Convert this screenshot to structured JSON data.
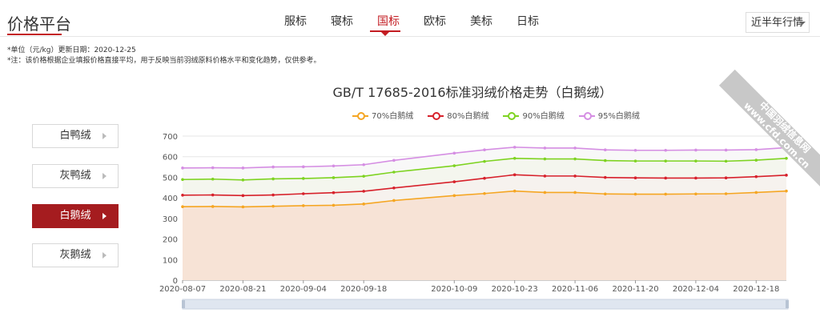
{
  "header": {
    "brand": "价格平台",
    "tabs": [
      {
        "label": "服标",
        "active": false
      },
      {
        "label": "寝标",
        "active": false
      },
      {
        "label": "国标",
        "active": true
      },
      {
        "label": "欧标",
        "active": false
      },
      {
        "label": "美标",
        "active": false
      },
      {
        "label": "日标",
        "active": false
      }
    ],
    "range_select": "近半年行情"
  },
  "notes": {
    "unit": "*单位（元/kg）更新日期：2020-12-25",
    "disclaimer": "*注：该价格根据企业填报价格直接平均，用于反映当前羽绒原料价格水平和变化趋势，仅供参考。"
  },
  "sidebar": {
    "items": [
      {
        "label": "白鸭绒",
        "active": false
      },
      {
        "label": "灰鸭绒",
        "active": false
      },
      {
        "label": "白鹅绒",
        "active": true
      },
      {
        "label": "灰鹅绒",
        "active": false
      }
    ]
  },
  "watermark": {
    "line1": "中国羽绒信息网",
    "line2": "www.cfd.com.cn"
  },
  "chart_data": {
    "type": "area",
    "title": "GB/T 17685-2016标准羽绒价格走势（白鹅绒）",
    "x_tick_labels": [
      "2020-08-07",
      "2020-08-21",
      "2020-09-04",
      "2020-09-18",
      "2020-10-09",
      "2020-10-23",
      "2020-11-06",
      "2020-11-20",
      "2020-12-04",
      "2020-12-18"
    ],
    "ylim": [
      0,
      700
    ],
    "y_ticks": [
      0,
      100,
      200,
      300,
      400,
      500,
      600,
      700
    ],
    "grid": true,
    "legend_position": "top-center",
    "x": [
      "2020-08-07",
      "2020-08-14",
      "2020-08-21",
      "2020-08-28",
      "2020-09-04",
      "2020-09-11",
      "2020-09-18",
      "2020-09-25",
      "2020-10-09",
      "2020-10-16",
      "2020-10-23",
      "2020-10-30",
      "2020-11-06",
      "2020-11-13",
      "2020-11-20",
      "2020-11-27",
      "2020-12-04",
      "2020-12-11",
      "2020-12-18",
      "2020-12-25"
    ],
    "series": [
      {
        "name": "70%白鹅绒",
        "color": "#f5a623",
        "fill": "#f7e3d6",
        "values": [
          357,
          358,
          356,
          359,
          362,
          364,
          370,
          387,
          411,
          421,
          433,
          426,
          426,
          419,
          418,
          418,
          419,
          420,
          426,
          433
        ]
      },
      {
        "name": "80%白鹅绒",
        "color": "#d7212b",
        "fill": "#f6f2ee",
        "values": [
          413,
          414,
          411,
          414,
          420,
          425,
          432,
          448,
          478,
          495,
          512,
          506,
          506,
          499,
          497,
          496,
          496,
          497,
          503,
          510
        ]
      },
      {
        "name": "90%白鹅绒",
        "color": "#7ed321",
        "fill": "#f4f6ee",
        "values": [
          489,
          491,
          487,
          492,
          494,
          498,
          505,
          525,
          556,
          577,
          592,
          589,
          589,
          581,
          579,
          579,
          579,
          578,
          583,
          592
        ]
      },
      {
        "name": "95%白鹅绒",
        "color": "#d58ee3",
        "fill": "#f8f8f8",
        "values": [
          545,
          546,
          545,
          550,
          551,
          555,
          561,
          582,
          617,
          633,
          646,
          642,
          642,
          633,
          631,
          631,
          632,
          632,
          634,
          644
        ]
      }
    ]
  }
}
